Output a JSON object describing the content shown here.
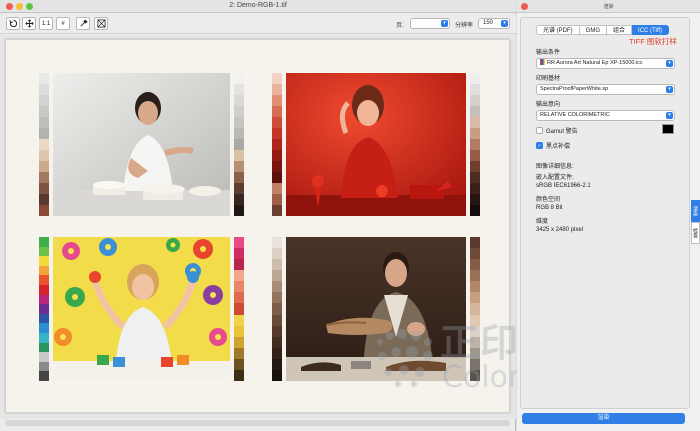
{
  "window": {
    "title": "2: Demo-RGB-1.tif"
  },
  "toolbar": {
    "buttons": [
      {
        "name": "rotate-button",
        "icon": "rotate-icon",
        "label": ""
      },
      {
        "name": "fit-button",
        "icon": "fit-arrows-icon",
        "label": ""
      },
      {
        "name": "actual-size-button",
        "icon": "",
        "label": "1:1"
      },
      {
        "name": "grid-button",
        "icon": "",
        "label": "#"
      },
      {
        "name": "eyedropper-button",
        "icon": "eyedropper-icon",
        "label": ""
      },
      {
        "name": "compare-button",
        "icon": "compare-icon",
        "label": ""
      }
    ],
    "page_label": "页:",
    "page_value": "",
    "resolution_label": "分辨率",
    "resolution_value": "150"
  },
  "panel": {
    "title": "渲染",
    "tabs": [
      {
        "label": "光谱 (PDF)",
        "active": false
      },
      {
        "label": "GMG",
        "active": false
      },
      {
        "label": "组合",
        "active": false
      },
      {
        "label": "ICC (Tiff)",
        "active": true
      }
    ],
    "tiff_proof_label": "TIFF 图软打样",
    "output_condition_label": "输出条件",
    "output_condition_value": "RR Aurora Art Natural Ep XP-15000.icc",
    "substrate_label": "印刷基材",
    "substrate_value": "SpectraProofPaperWhite.sp",
    "intent_label": "输出意向",
    "intent_value": "RELATIVE COLORIMETRIC",
    "gamut_warning_label": "Gamut 警告",
    "gamut_warning_checked": false,
    "gamut_warning_color": "#000000",
    "black_point_label": "黑点补偿",
    "black_point_checked": true,
    "image_info_title": "图像详细信息:",
    "embedded_profile_label": "嵌入配置文件:",
    "embedded_profile_value": "sRGB IEC61966-2.1",
    "color_space_label": "颜色空间",
    "color_space_value": "RGB 8 Bit",
    "dimensions_label": "维度",
    "dimensions_value": "3425 x 2480 pixel",
    "side_tabs": [
      {
        "label": "渲染",
        "active": true
      },
      {
        "label": "检查",
        "active": false
      }
    ],
    "render_button_label": "渲染"
  },
  "watermark": {
    "cn": "正印科技",
    "en": "ColorSpace"
  },
  "colors": {
    "accent": "#2f7fe6",
    "tiff_label": "#e2402f"
  }
}
